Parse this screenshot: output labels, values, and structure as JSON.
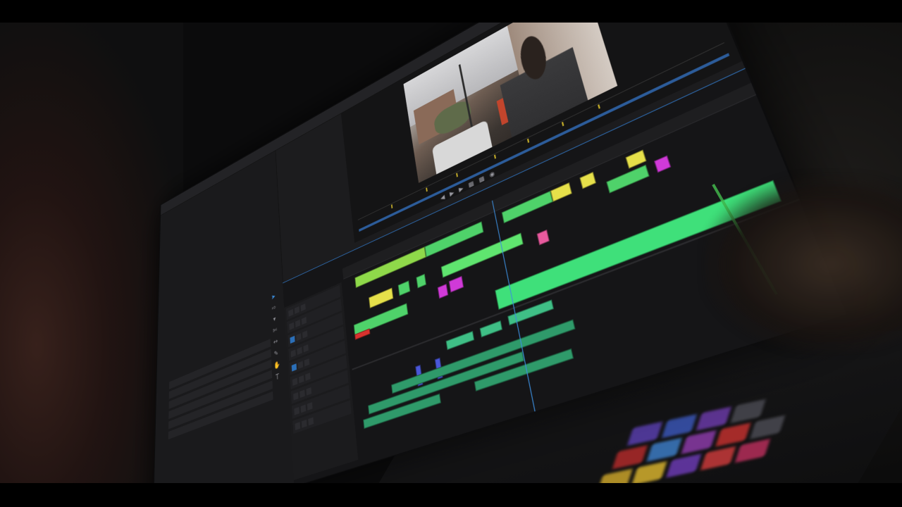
{
  "photo": {
    "subject": "",
    "tabs": [
      {
        "label": "",
        "active": false
      },
      {
        "label": "",
        "active": false
      },
      {
        "label": "",
        "active": false
      },
      {
        "label": "",
        "active": true
      }
    ],
    "timecode": "",
    "sequence_tab": "",
    "effects_tabs": [
      "",
      ""
    ],
    "ruler_marks": [
      "",
      "",
      "",
      "",
      "",
      ""
    ],
    "tool_icons": [
      "selection-tool-icon",
      "track-select-icon",
      "ripple-edit-icon",
      "razor-tool-icon",
      "slip-tool-icon",
      "pen-tool-icon",
      "hand-tool-icon",
      "type-tool-icon"
    ],
    "colors": {
      "timecode_blue": "#3f95ea",
      "clip_green": "#4fd26a",
      "clip_bright_green": "#5fe56f",
      "clip_yellow": "#e6e04a",
      "clip_magenta": "#d03ad8",
      "clip_pink": "#e85a9e",
      "clip_red": "#d8322e",
      "audio_teal": "#3fbf86",
      "audio_blue": "#4a57d8"
    }
  }
}
